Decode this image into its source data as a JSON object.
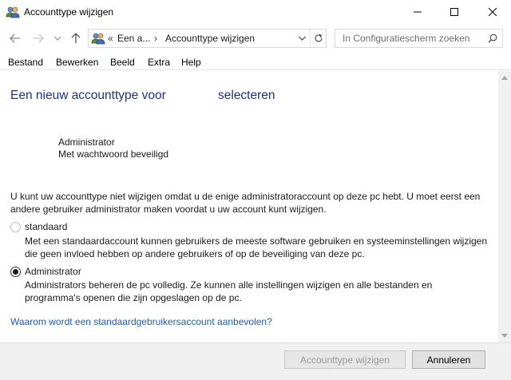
{
  "window": {
    "title": "Accounttype wijzigen",
    "controls": {
      "minimize": "minimize",
      "maximize": "maximize",
      "close": "close"
    }
  },
  "address_bar": {
    "overflow": "«",
    "crumbs": [
      "Een a...",
      "Accounttype wijzigen"
    ],
    "separator": "›"
  },
  "search": {
    "placeholder": "In Configuratiescherm zoeken"
  },
  "menu": {
    "items": [
      "Bestand",
      "Bewerken",
      "Beeld",
      "Extra",
      "Help"
    ]
  },
  "main": {
    "heading_part1": "Een nieuw accounttype voor",
    "heading_part2": "selecteren",
    "account": {
      "type": "Administrator",
      "status": "Met wachtwoord beveiligd"
    },
    "info_text": "U kunt uw accounttype niet wijzigen omdat u de enige administratoraccount op deze pc hebt. U moet eerst een andere gebruiker administrator maken voordat u uw account kunt wijzigen.",
    "options": [
      {
        "label": "standaard",
        "checked": false,
        "enabled": false,
        "description": "Met een standaardaccount kunnen gebruikers de meeste software gebruiken en systeeminstellingen wijzigen die geen invloed hebben op andere gebruikers of op de beveiliging van deze pc."
      },
      {
        "label": "Administrator",
        "checked": true,
        "enabled": true,
        "description": "Administrators beheren de pc volledig. Ze kunnen alle instellingen wijzigen en alle bestanden en programma's openen die zijn opgeslagen op de pc."
      }
    ],
    "help_link": "Waarom wordt een standaardgebruikersaccount aanbevolen?"
  },
  "footer": {
    "primary_button": "Accounttype wijzigen",
    "cancel_button": "Annuleren"
  },
  "colors": {
    "heading": "#1e3287",
    "link": "#1a5cb4",
    "footer_bg": "#f0f0f0"
  }
}
